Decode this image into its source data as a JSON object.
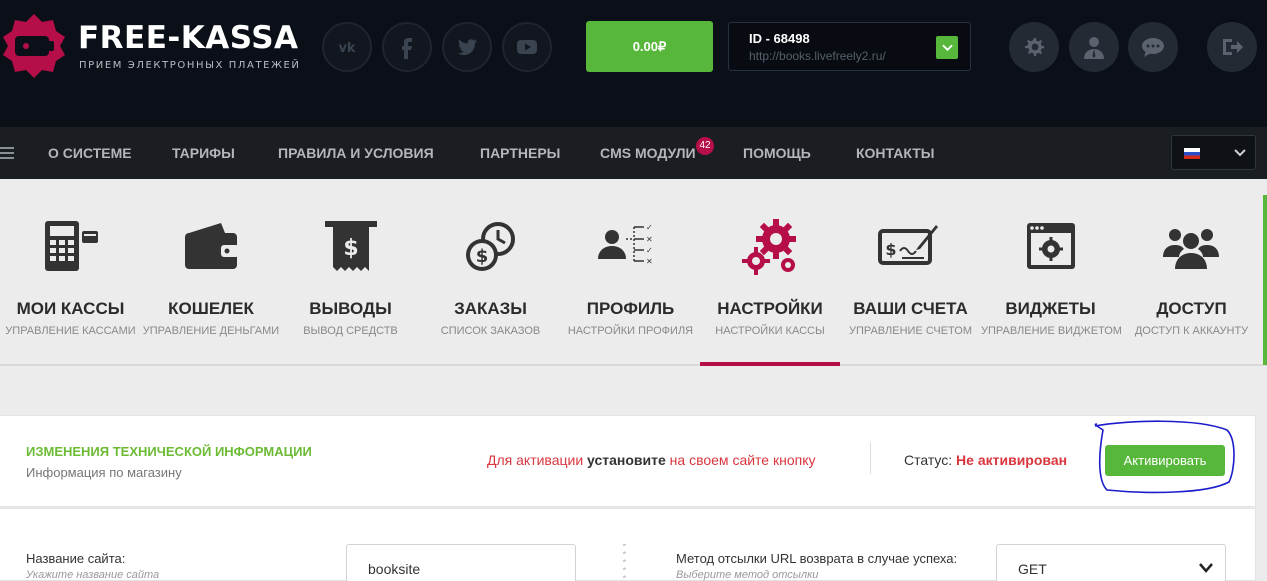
{
  "brand": {
    "title": "FREE-KASSA",
    "subtitle": "ПРИЕМ ЭЛЕКТРОННЫХ ПЛАТЕЖЕЙ"
  },
  "social": [
    "vk-icon",
    "facebook-icon",
    "twitter-icon",
    "youtube-icon"
  ],
  "balance": "0.00₽",
  "shop": {
    "id": "ID - 68498",
    "url": "http://books.livefreely2.ru/"
  },
  "tools": [
    "gear-icon",
    "user-icon",
    "chat-icon",
    "logout-icon"
  ],
  "nav": {
    "items": [
      "О СИСТЕМЕ",
      "ТАРИФЫ",
      "ПРАВИЛА И УСЛОВИЯ",
      "ПАРТНЕРЫ",
      "CMS МОДУЛИ",
      "ПОМОЩЬ",
      "КОНТАКТЫ"
    ],
    "cms_badge": "42",
    "language": "ru"
  },
  "tabs": [
    {
      "title": "МОИ КАССЫ",
      "sub": "УПРАВЛЕНИЕ КАССАМИ",
      "icon": "calculator-icon"
    },
    {
      "title": "КОШЕЛЕК",
      "sub": "УПРАВЛЕНИЕ ДЕНЬГАМИ",
      "icon": "wallet-icon"
    },
    {
      "title": "ВЫВОДЫ",
      "sub": "ВЫВОД СРЕДСТВ",
      "icon": "receipt-icon"
    },
    {
      "title": "ЗАКАЗЫ",
      "sub": "СПИСОК ЗАКАЗОВ",
      "icon": "coins-clock-icon"
    },
    {
      "title": "ПРОФИЛЬ",
      "sub": "НАСТРОЙКИ ПРОФИЛЯ",
      "icon": "profile-icon"
    },
    {
      "title": "НАСТРОЙКИ",
      "sub": "НАСТРОЙКИ КАССЫ",
      "icon": "gears-icon"
    },
    {
      "title": "ВАШИ СЧЕТА",
      "sub": "УПРАВЛЕНИЕ СЧЕТОМ",
      "icon": "check-icon"
    },
    {
      "title": "ВИДЖЕТЫ",
      "sub": "УПРАВЛЕНИЕ ВИДЖЕТОМ",
      "icon": "widget-icon"
    },
    {
      "title": "ДОСТУП",
      "sub": "ДОСТУП К АККАУНТУ",
      "icon": "group-icon"
    }
  ],
  "active_tab": "НАСТРОЙКИ",
  "panel": {
    "title": "ИЗМЕНЕНИЯ ТЕХНИЧЕСКОЙ ИНФОРМАЦИИ",
    "subtitle": "Информация по магазину",
    "notice_a": "Для активации ",
    "notice_b": "установите",
    "notice_c": " на своем сайте кнопку",
    "status_label": "Статус: ",
    "status_value": "Не активирован",
    "activate": "Активировать"
  },
  "form": {
    "site_name_label": "Название сайта:",
    "site_name_hint": "Укажите название сайта",
    "site_name_value": "booksite",
    "method_label": "Метод отсылки URL возврата в случае успеха:",
    "method_hint": "Выберите метод отсылки",
    "method_value": "GET"
  },
  "colors": {
    "green": "#57b73b",
    "crimson": "#b50e48",
    "alert": "#d9363e",
    "dark": "#0b1018"
  }
}
